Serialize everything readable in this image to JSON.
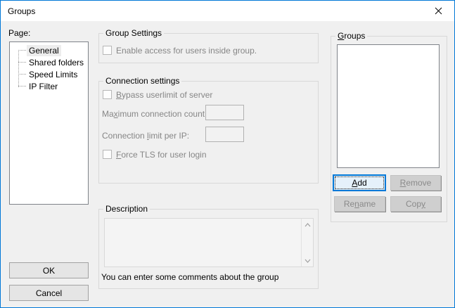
{
  "window": {
    "title": "Groups"
  },
  "page_panel": {
    "label": "Page:",
    "tree_items": [
      "General",
      "Shared folders",
      "Speed Limits",
      "IP Filter"
    ],
    "selected_item": "General",
    "ok_label": "OK",
    "cancel_label": "Cancel"
  },
  "group_settings": {
    "title": "Group Settings",
    "enable_access_label": "Enable access for users inside group.",
    "enable_access_checked": false
  },
  "connection_settings": {
    "title": "Connection settings",
    "bypass_checkbox": {
      "pre": "",
      "key": "B",
      "post": "ypass userlimit of server",
      "checked": false
    },
    "max_connections": {
      "label_pre": "Ma",
      "label_key": "x",
      "label_post": "imum connection count:",
      "value": ""
    },
    "ip_limit": {
      "label_pre": "Connection ",
      "label_key": "l",
      "label_post": "imit per IP:",
      "value": ""
    },
    "force_tls_checkbox": {
      "pre": "",
      "key": "F",
      "post": "orce TLS for user login",
      "checked": false
    }
  },
  "description": {
    "title": "Description",
    "value": "",
    "caption": "You can enter some comments about the group"
  },
  "groups_panel": {
    "title": {
      "pre": "",
      "key": "G",
      "post": "roups"
    },
    "list_items": [],
    "add_button": {
      "pre": "",
      "key": "A",
      "post": "dd",
      "enabled": true,
      "focused": true
    },
    "remove_button": {
      "pre": "",
      "key": "R",
      "post": "emove",
      "enabled": false
    },
    "rename_button": {
      "pre": "Re",
      "key": "n",
      "post": "ame",
      "enabled": false
    },
    "copy_button": {
      "pre": "Cop",
      "key": "y",
      "post": "",
      "enabled": false
    }
  },
  "colors": {
    "accent": "#0078d7",
    "dialog_bg": "#f0f0f0",
    "titlebar_bg": "#ffffff",
    "disabled_text": "#868686",
    "focused_button_bg": "#e5f1fb"
  }
}
